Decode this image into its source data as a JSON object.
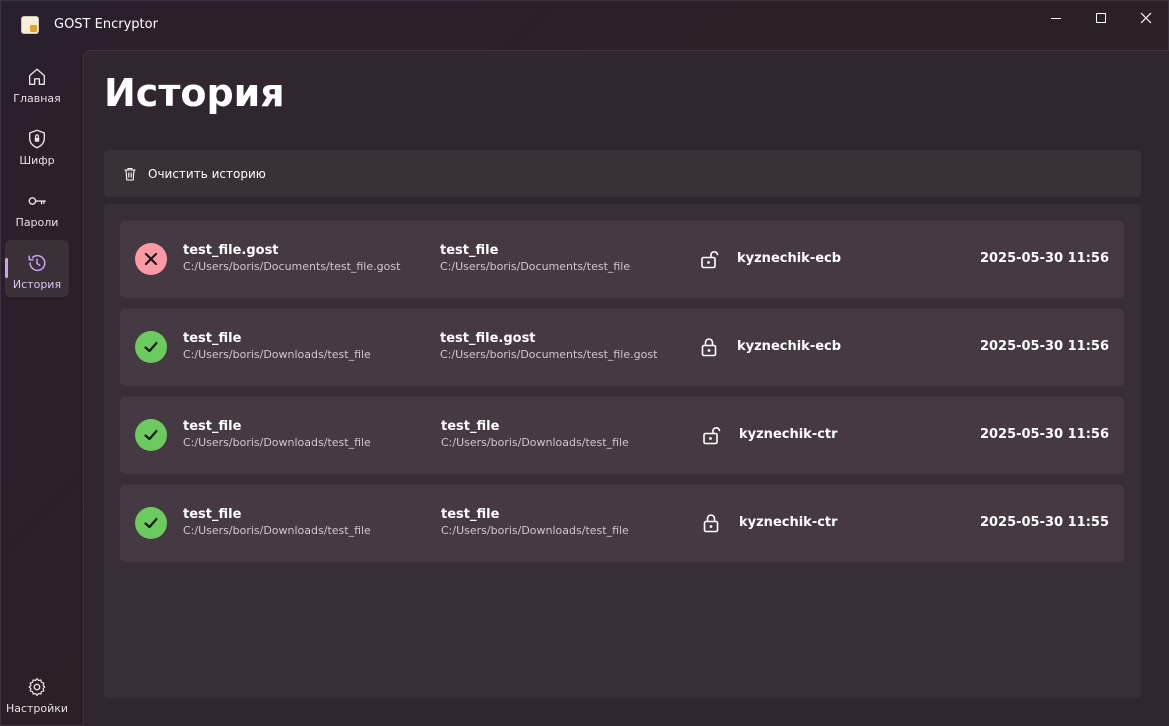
{
  "window": {
    "title": "GOST Encryptor",
    "controls": [
      "minimize-icon",
      "maximize-icon",
      "close-icon"
    ]
  },
  "sidebar": {
    "items": [
      {
        "label": "Главная",
        "icon": "home-icon"
      },
      {
        "label": "Шифр",
        "icon": "shield-lock-icon"
      },
      {
        "label": "Пароли",
        "icon": "key-icon"
      },
      {
        "label": "История",
        "icon": "history-icon",
        "active": true
      }
    ],
    "settings": {
      "label": "Настройки",
      "icon": "gear-icon"
    }
  },
  "page": {
    "title": "История",
    "toolbar": {
      "clear_label": "Очистить историю",
      "icon": "trash-icon"
    }
  },
  "history": [
    {
      "status": "error",
      "source": {
        "name": "test_file.gost",
        "path": "C:/Users/boris/Documents/test_file.gost"
      },
      "target": {
        "name": "test_file",
        "path": "C:/Users/boris/Documents/test_file"
      },
      "operation": "decrypt",
      "algorithm": "kyznechik-ecb",
      "date": "2025-05-30 11:56"
    },
    {
      "status": "success",
      "source": {
        "name": "test_file",
        "path": "C:/Users/boris/Downloads/test_file"
      },
      "target": {
        "name": "test_file.gost",
        "path": "C:/Users/boris/Documents/test_file.gost"
      },
      "operation": "encrypt",
      "algorithm": "kyznechik-ecb",
      "date": "2025-05-30 11:56"
    },
    {
      "status": "success",
      "source": {
        "name": "test_file",
        "path": "C:/Users/boris/Downloads/test_file"
      },
      "target": {
        "name": "test_file",
        "path": "C:/Users/boris/Downloads/test_file"
      },
      "operation": "decrypt",
      "algorithm": "kyznechik-ctr",
      "date": "2025-05-30 11:56"
    },
    {
      "status": "success",
      "source": {
        "name": "test_file",
        "path": "C:/Users/boris/Downloads/test_file"
      },
      "target": {
        "name": "test_file",
        "path": "C:/Users/boris/Downloads/test_file"
      },
      "operation": "encrypt",
      "algorithm": "kyznechik-ctr",
      "date": "2025-05-30 11:55"
    }
  ],
  "colors": {
    "success": "#6ccb5f",
    "error": "#ff99a4",
    "accent": "#c8a4f0"
  }
}
